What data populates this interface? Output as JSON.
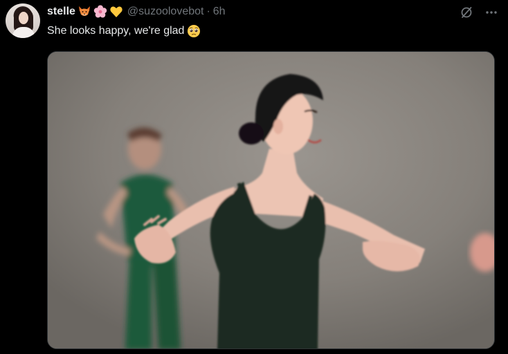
{
  "tweet": {
    "display_name": "stelle",
    "handle": "@suzoolovebot",
    "separator": "·",
    "time": "6h",
    "text": "She looks happy, we're glad",
    "name_emojis": [
      "fox-emoji",
      "cherry-blossom-emoji",
      "yellow-heart-emoji"
    ],
    "text_emoji": "pleading-face-emoji"
  },
  "actions": {
    "grok_icon": "grok-icon",
    "more_icon": "more-dots-icon"
  },
  "colors": {
    "background": "#000000",
    "text_primary": "#e7e9ea",
    "text_secondary": "#71767b",
    "border": "#2f3336",
    "leotard": "#1f2a22",
    "background_dancer": "#1f5a3c"
  }
}
